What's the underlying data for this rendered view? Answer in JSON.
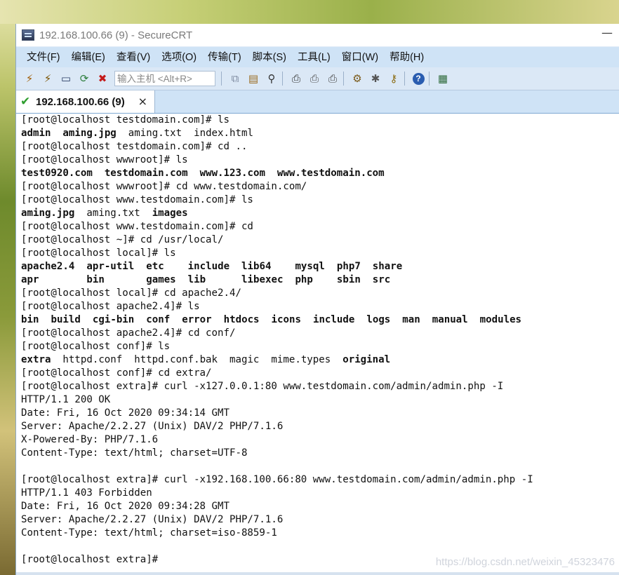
{
  "window": {
    "title": "192.168.100.66 (9) - SecureCRT",
    "minimize_label": "—"
  },
  "menu": [
    "文件(F)",
    "编辑(E)",
    "查看(V)",
    "选项(O)",
    "传输(T)",
    "脚本(S)",
    "工具(L)",
    "窗口(W)",
    "帮助(H)"
  ],
  "toolbar": {
    "quick_connect_placeholder": "输入主机 <Alt+R>",
    "buttons": [
      {
        "name": "connect-icon",
        "glyph": "⚡"
      },
      {
        "name": "quick-connect-icon",
        "glyph": "⚡"
      },
      {
        "name": "connect-tab-icon",
        "glyph": "▭"
      },
      {
        "name": "reconnect-icon",
        "glyph": "⟳"
      },
      {
        "name": "disconnect-icon",
        "glyph": "✖"
      }
    ],
    "buttons2": [
      {
        "name": "copy-icon",
        "glyph": "⧉"
      },
      {
        "name": "paste-icon",
        "glyph": "📋"
      },
      {
        "name": "find-icon",
        "glyph": "🔭"
      }
    ],
    "buttons3": [
      {
        "name": "print-screen-icon",
        "glyph": "🖨"
      },
      {
        "name": "print-selection-icon",
        "glyph": "🖶"
      },
      {
        "name": "print-icon",
        "glyph": "🖨"
      }
    ],
    "buttons4": [
      {
        "name": "session-options-icon",
        "glyph": "⚙"
      },
      {
        "name": "global-options-icon",
        "glyph": "✱"
      },
      {
        "name": "keymap-icon",
        "glyph": "🔑"
      }
    ],
    "buttons5": [
      {
        "name": "help-icon",
        "glyph": "?"
      }
    ],
    "buttons6": [
      {
        "name": "sftp-icon",
        "glyph": "▦"
      }
    ]
  },
  "tab": {
    "label": "192.168.100.66 (9)",
    "close": "×"
  },
  "terminal": {
    "lines": [
      [
        {
          "t": "[root@localhost testdomain.com]# ls"
        }
      ],
      [
        {
          "t": "admin",
          "b": true
        },
        {
          "t": "  "
        },
        {
          "t": "aming.jpg",
          "b": true
        },
        {
          "t": "  aming.txt  index.html"
        }
      ],
      [
        {
          "t": "[root@localhost testdomain.com]# cd .."
        }
      ],
      [
        {
          "t": "[root@localhost wwwroot]# ls"
        }
      ],
      [
        {
          "t": "test0920.com",
          "b": true
        },
        {
          "t": "  "
        },
        {
          "t": "testdomain.com",
          "b": true
        },
        {
          "t": "  "
        },
        {
          "t": "www.123.com",
          "b": true
        },
        {
          "t": "  "
        },
        {
          "t": "www.testdomain.com",
          "b": true
        }
      ],
      [
        {
          "t": "[root@localhost wwwroot]# cd www.testdomain.com/"
        }
      ],
      [
        {
          "t": "[root@localhost www.testdomain.com]# ls"
        }
      ],
      [
        {
          "t": "aming.jpg",
          "b": true
        },
        {
          "t": "  aming.txt  "
        },
        {
          "t": "images",
          "b": true
        }
      ],
      [
        {
          "t": "[root@localhost www.testdomain.com]# cd"
        }
      ],
      [
        {
          "t": "[root@localhost ~]# cd /usr/local/"
        }
      ],
      [
        {
          "t": "[root@localhost local]# ls"
        }
      ],
      [
        {
          "t": "apache2.4",
          "b": true
        },
        {
          "t": "  "
        },
        {
          "t": "apr-util",
          "b": true
        },
        {
          "t": "  "
        },
        {
          "t": "etc",
          "b": true
        },
        {
          "t": "    "
        },
        {
          "t": "include",
          "b": true
        },
        {
          "t": "  "
        },
        {
          "t": "lib64",
          "b": true
        },
        {
          "t": "    "
        },
        {
          "t": "mysql",
          "b": true
        },
        {
          "t": "  "
        },
        {
          "t": "php7",
          "b": true
        },
        {
          "t": "  "
        },
        {
          "t": "share",
          "b": true
        }
      ],
      [
        {
          "t": "apr",
          "b": true
        },
        {
          "t": "        "
        },
        {
          "t": "bin",
          "b": true
        },
        {
          "t": "       "
        },
        {
          "t": "games",
          "b": true
        },
        {
          "t": "  "
        },
        {
          "t": "lib",
          "b": true
        },
        {
          "t": "      "
        },
        {
          "t": "libexec",
          "b": true
        },
        {
          "t": "  "
        },
        {
          "t": "php",
          "b": true
        },
        {
          "t": "    "
        },
        {
          "t": "sbin",
          "b": true
        },
        {
          "t": "  "
        },
        {
          "t": "src",
          "b": true
        }
      ],
      [
        {
          "t": "[root@localhost local]# cd apache2.4/"
        }
      ],
      [
        {
          "t": "[root@localhost apache2.4]# ls"
        }
      ],
      [
        {
          "t": "bin",
          "b": true
        },
        {
          "t": "  "
        },
        {
          "t": "build",
          "b": true
        },
        {
          "t": "  "
        },
        {
          "t": "cgi-bin",
          "b": true
        },
        {
          "t": "  "
        },
        {
          "t": "conf",
          "b": true
        },
        {
          "t": "  "
        },
        {
          "t": "error",
          "b": true
        },
        {
          "t": "  "
        },
        {
          "t": "htdocs",
          "b": true
        },
        {
          "t": "  "
        },
        {
          "t": "icons",
          "b": true
        },
        {
          "t": "  "
        },
        {
          "t": "include",
          "b": true
        },
        {
          "t": "  "
        },
        {
          "t": "logs",
          "b": true
        },
        {
          "t": "  "
        },
        {
          "t": "man",
          "b": true
        },
        {
          "t": "  "
        },
        {
          "t": "manual",
          "b": true
        },
        {
          "t": "  "
        },
        {
          "t": "modules",
          "b": true
        }
      ],
      [
        {
          "t": "[root@localhost apache2.4]# cd conf/"
        }
      ],
      [
        {
          "t": "[root@localhost conf]# ls"
        }
      ],
      [
        {
          "t": "extra",
          "b": true
        },
        {
          "t": "  httpd.conf  httpd.conf.bak  magic  mime.types  "
        },
        {
          "t": "original",
          "b": true
        }
      ],
      [
        {
          "t": "[root@localhost conf]# cd extra/"
        }
      ],
      [
        {
          "t": "[root@localhost extra]# curl -x127.0.0.1:80 www.testdomain.com/admin/admin.php -I"
        }
      ],
      [
        {
          "t": "HTTP/1.1 200 OK"
        }
      ],
      [
        {
          "t": "Date: Fri, 16 Oct 2020 09:34:14 GMT"
        }
      ],
      [
        {
          "t": "Server: Apache/2.2.27 (Unix) DAV/2 PHP/7.1.6"
        }
      ],
      [
        {
          "t": "X-Powered-By: PHP/7.1.6"
        }
      ],
      [
        {
          "t": "Content-Type: text/html; charset=UTF-8"
        }
      ],
      [
        {
          "t": ""
        }
      ],
      [
        {
          "t": "[root@localhost extra]# curl -x192.168.100.66:80 www.testdomain.com/admin/admin.php -I"
        }
      ],
      [
        {
          "t": "HTTP/1.1 403 Forbidden"
        }
      ],
      [
        {
          "t": "Date: Fri, 16 Oct 2020 09:34:28 GMT"
        }
      ],
      [
        {
          "t": "Server: Apache/2.2.27 (Unix) DAV/2 PHP/7.1.6"
        }
      ],
      [
        {
          "t": "Content-Type: text/html; charset=iso-8859-1"
        }
      ],
      [
        {
          "t": ""
        }
      ],
      [
        {
          "t": "[root@localhost extra]#"
        }
      ]
    ]
  },
  "watermark": "https://blog.csdn.net/weixin_45323476"
}
